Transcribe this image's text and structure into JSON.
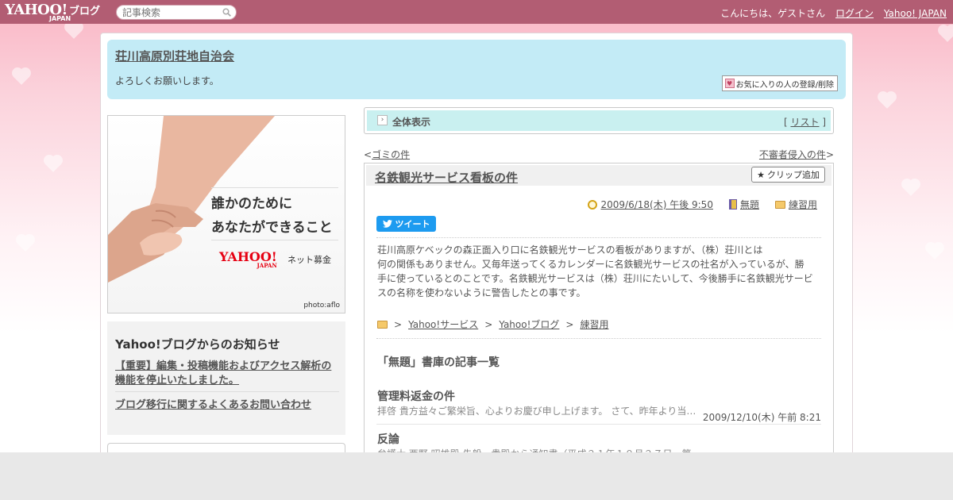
{
  "topbar": {
    "logo_text": "YAHOO!",
    "logo_sub": "JAPAN",
    "blog_text": "ブログ",
    "search_placeholder": "記事検索",
    "greeting": "こんにちは、ゲストさん",
    "login_label": "ログイン",
    "yahoo_japan_label": "Yahoo! JAPAN"
  },
  "header": {
    "blog_title": "荘川高原別荘地自治会",
    "description": "よろしくお願いします。",
    "favorite_button": "お気に入りの人の登録/削除"
  },
  "banner": {
    "line1": "誰かのために",
    "line2": "あなたができること",
    "logo": "YAHOO!",
    "logo_sub": "JAPAN",
    "net": "ネット募金",
    "credit": "photo:aflo"
  },
  "notice": {
    "heading": "Yahoo!ブログからのお知らせ",
    "item1": "【重要】編集・投稿機能およびアクセス解析の機能を停止いたしました。",
    "item2": "ブログ移行に関するよくあるお問い合わせ"
  },
  "view_bar": {
    "label": "全体表示",
    "list_open": "[ ",
    "list_label": "リスト",
    "list_close": " ]"
  },
  "nav": {
    "prev_prefix": "<",
    "prev_label": "ゴミの件",
    "next_label": "不審者侵入の件",
    "next_suffix": ">"
  },
  "article": {
    "title": "名鉄観光サービス看板の件",
    "clip_button": "クリップ追加",
    "date": "2009/6/18(木) 午後 9:50",
    "category1": "無題",
    "category2": "練習用",
    "tweet_label": "ツイート",
    "body_line1": "荘川高原ケベックの森正面入り口に名鉄観光サービスの看板がありますが、（株）荘川とは",
    "body_line2": "何の関係もありません。又毎年送ってくるカレンダーに名鉄観光サービスの社名が入っているが、勝",
    "body_line3": "手に使っているとのことです。名鉄観光サービスは（株）荘川にたいして、今後勝手に名鉄観光サービ",
    "body_line4": "スの名称を使わないように警告したとの事です。",
    "crumb1": "Yahoo!サービス",
    "crumb2": "Yahoo!ブログ",
    "crumb3": "練習用",
    "crumb_sep": ">"
  },
  "entries": {
    "heading": "「無題」書庫の記事一覧",
    "items": [
      {
        "title": "管理料返金の件",
        "snippet": "拝啓 貴方益々ご繁栄旨、心よりお慶び申し上げます。 さて、昨年より当…",
        "date": "2009/12/10(木) 午前 8:21"
      },
      {
        "title": "反論",
        "snippet": "弁護士 西野 昭雄殿 先般、貴殿から通知書（平成２１年１０月２７日、第"
      }
    ]
  },
  "colors": {
    "topbar": "#b25d73",
    "header_bg": "#c3ebf6",
    "view_bar_bg": "#c9f0f0",
    "tweet": "#1d9bf0"
  }
}
